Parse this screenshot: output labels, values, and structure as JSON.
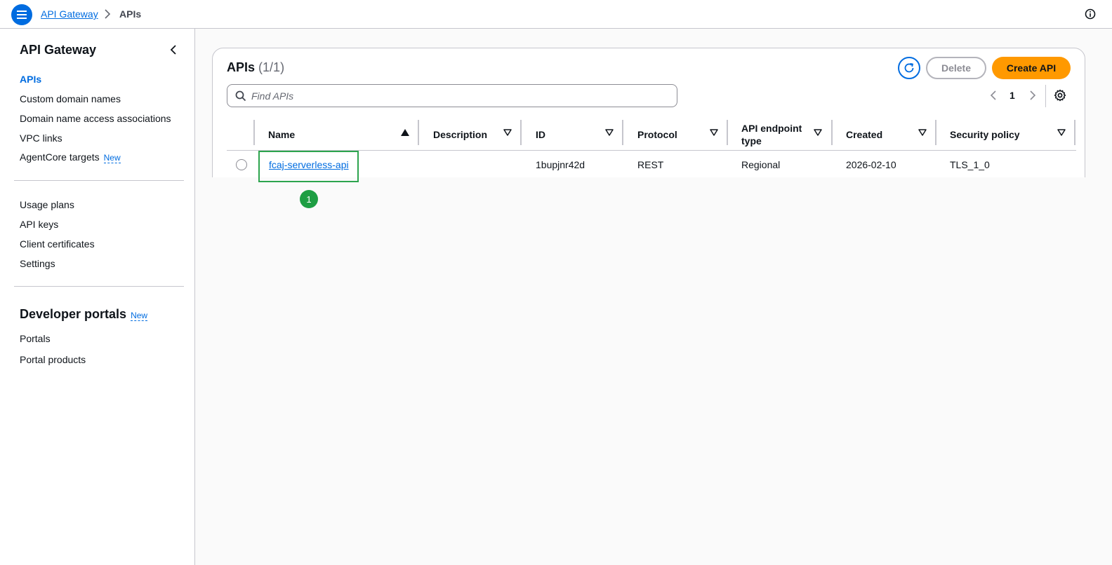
{
  "header": {
    "breadcrumb_service": "API Gateway",
    "breadcrumb_current": "APIs"
  },
  "sidebar": {
    "title": "API Gateway",
    "items_top": [
      {
        "label": "APIs",
        "active": true
      },
      {
        "label": "Custom domain names"
      },
      {
        "label": "Domain name access associations"
      },
      {
        "label": "VPC links"
      },
      {
        "label": "AgentCore targets",
        "badge": "New"
      }
    ],
    "items_mid": [
      {
        "label": "Usage plans"
      },
      {
        "label": "API keys"
      },
      {
        "label": "Client certificates"
      },
      {
        "label": "Settings"
      }
    ],
    "section_title": "Developer portals",
    "section_badge": "New",
    "items_bottom": [
      {
        "label": "Portals"
      },
      {
        "label": "Portal products"
      }
    ]
  },
  "panel": {
    "title": "APIs",
    "count": "(1/1)",
    "delete_label": "Delete",
    "create_label": "Create API",
    "search_placeholder": "Find APIs",
    "page": "1"
  },
  "table": {
    "columns": [
      "Name",
      "Description",
      "ID",
      "Protocol",
      "API endpoint type",
      "Created",
      "Security policy"
    ],
    "rows": [
      {
        "name": "fcaj-serverless-api",
        "description": "",
        "id": "1bupjnr42d",
        "protocol": "REST",
        "endpoint_type": "Regional",
        "created": "2026-02-10",
        "security_policy": "TLS_1_0"
      }
    ]
  },
  "annotation": {
    "step": "1",
    "color": "#2da44e"
  },
  "colors": {
    "link": "#006ce0",
    "primary_button": "#ff9900",
    "border": "#c6c6cd"
  }
}
